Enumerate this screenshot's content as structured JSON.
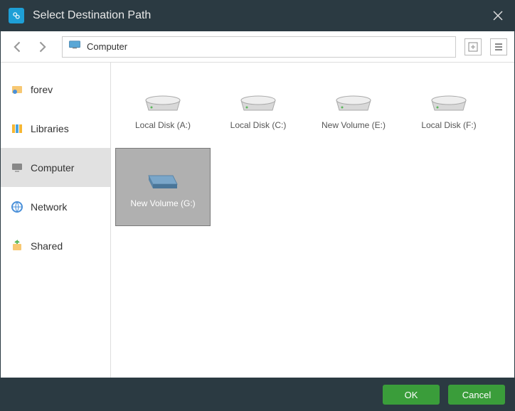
{
  "window": {
    "title": "Select Destination Path"
  },
  "path": {
    "location": "Computer"
  },
  "sidebar": {
    "items": [
      {
        "label": "forev"
      },
      {
        "label": "Libraries"
      },
      {
        "label": "Computer"
      },
      {
        "label": "Network"
      },
      {
        "label": "Shared"
      }
    ]
  },
  "drives": [
    {
      "label": "Local Disk (A:)",
      "selected": false,
      "kind": "disk"
    },
    {
      "label": "Local Disk (C:)",
      "selected": false,
      "kind": "disk"
    },
    {
      "label": "New Volume (E:)",
      "selected": false,
      "kind": "disk"
    },
    {
      "label": "Local Disk (F:)",
      "selected": false,
      "kind": "disk"
    },
    {
      "label": "New Volume (G:)",
      "selected": true,
      "kind": "volume"
    }
  ],
  "buttons": {
    "ok": "OK",
    "cancel": "Cancel"
  }
}
